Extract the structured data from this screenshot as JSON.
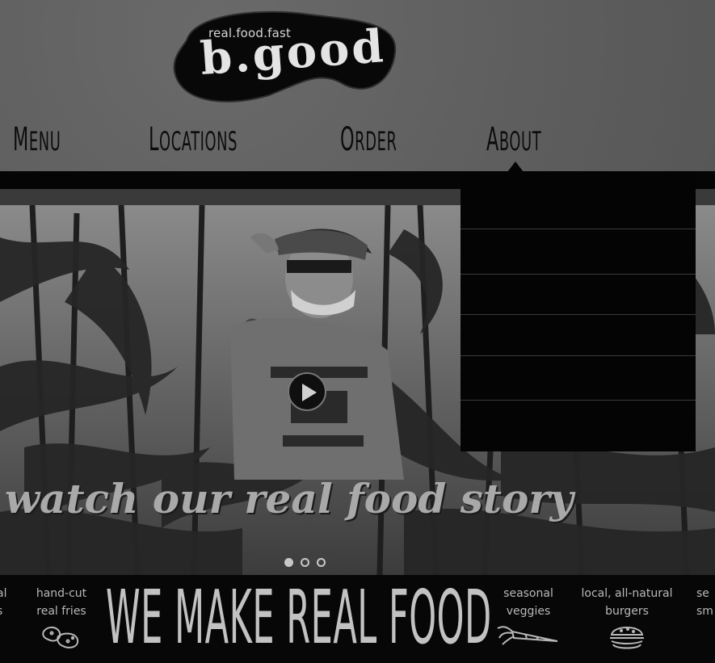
{
  "logo": {
    "tagline": "real.food.fast",
    "brand": "b.good"
  },
  "nav": {
    "items": [
      {
        "cap": "M",
        "rest": "ENU"
      },
      {
        "cap": "L",
        "rest": "OCATIONS"
      },
      {
        "cap": "O",
        "rest": "RDER"
      },
      {
        "cap": "A",
        "rest": "BOUT"
      }
    ]
  },
  "hero": {
    "tagline": "watch our real food story",
    "slides": 3,
    "active_slide": 1
  },
  "bottom": {
    "headline": "WE MAKE REAL FOOD",
    "features": [
      {
        "line1": "al",
        "line2": "s"
      },
      {
        "line1": "hand-cut",
        "line2": "real fries"
      },
      {
        "line1": "seasonal",
        "line2": "veggies"
      },
      {
        "line1": "local, all-natural",
        "line2": "burgers"
      },
      {
        "line1": "se",
        "line2": "sm"
      }
    ]
  },
  "colors": {
    "header_bg": "#5f5f5f",
    "navbar": "#050505",
    "dropdown": "#040404",
    "text_light": "#b8b8b8"
  }
}
